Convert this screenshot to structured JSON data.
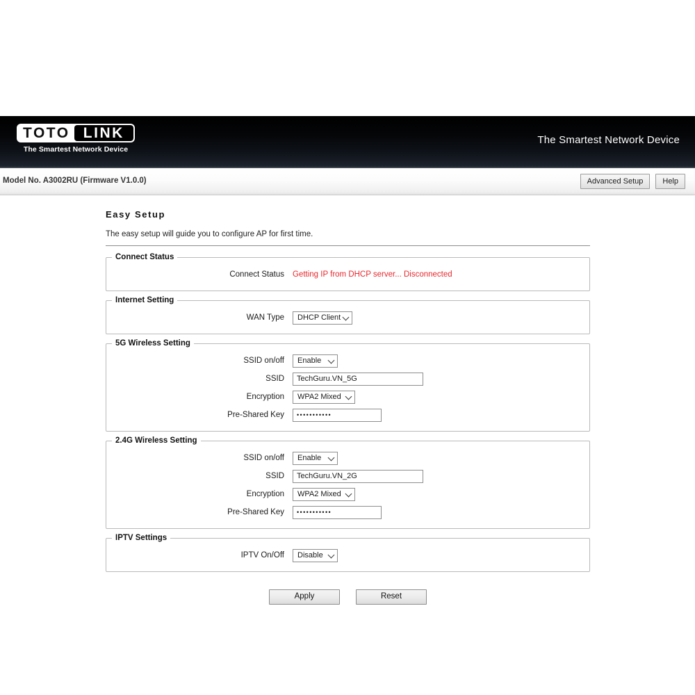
{
  "header": {
    "logo": {
      "part1": "TOTO",
      "part2": "LINK",
      "tagline": "The Smartest Network Device"
    },
    "slogan": "The Smartest Network Device"
  },
  "model_bar": {
    "model_text": "Model No. A3002RU (Firmware V1.0.0)",
    "advanced_setup_label": "Advanced Setup",
    "help_label": "Help"
  },
  "page": {
    "title": "Easy Setup",
    "description": "The easy setup will guide you to configure AP for first time."
  },
  "connect_status": {
    "legend": "Connect Status",
    "label": "Connect Status",
    "value": "Getting IP from DHCP server... Disconnected",
    "value_color": "#e8282d"
  },
  "internet_setting": {
    "legend": "Internet Setting",
    "wan_type_label": "WAN Type",
    "wan_type_value": "DHCP Client"
  },
  "wireless_5g": {
    "legend": "5G Wireless Setting",
    "ssid_onoff_label": "SSID on/off",
    "ssid_onoff_value": "Enable",
    "ssid_label": "SSID",
    "ssid_value": "TechGuru.VN_5G",
    "encryption_label": "Encryption",
    "encryption_value": "WPA2 Mixed",
    "psk_label": "Pre-Shared Key",
    "psk_value": "•••••••••••"
  },
  "wireless_24g": {
    "legend": "2.4G Wireless Setting",
    "ssid_onoff_label": "SSID on/off",
    "ssid_onoff_value": "Enable",
    "ssid_label": "SSID",
    "ssid_value": "TechGuru.VN_2G",
    "encryption_label": "Encryption",
    "encryption_value": "WPA2 Mixed",
    "psk_label": "Pre-Shared Key",
    "psk_value": "•••••••••••"
  },
  "iptv_settings": {
    "legend": "IPTV Settings",
    "iptv_onoff_label": "IPTV On/Off",
    "iptv_onoff_value": "Disable"
  },
  "actions": {
    "apply_label": "Apply",
    "reset_label": "Reset"
  }
}
